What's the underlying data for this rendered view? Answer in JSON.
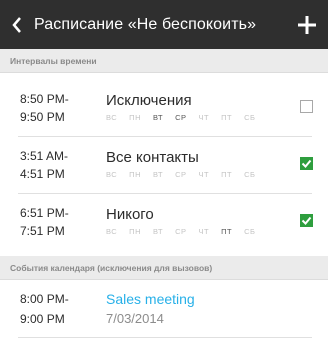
{
  "appbar": {
    "title": "Расписание «Не беспокоить»",
    "back_icon": "chevron-left-icon",
    "add_icon": "plus-icon"
  },
  "sections": {
    "intervals_header": "Интервалы времени",
    "calendar_header": "События календаря (исключения для вызовов)"
  },
  "intervals": [
    {
      "time_start": "8:50 PM-",
      "time_end": "9:50 PM",
      "name": "Исключения",
      "days": [
        {
          "label": "ВС",
          "on": false
        },
        {
          "label": "ПН",
          "on": false
        },
        {
          "label": "ВТ",
          "on": true
        },
        {
          "label": "СР",
          "on": true
        },
        {
          "label": "ЧТ",
          "on": false
        },
        {
          "label": "ПТ",
          "on": false
        },
        {
          "label": "СБ",
          "on": false
        }
      ],
      "checked": false
    },
    {
      "time_start": "3:51 AM-",
      "time_end": "4:51 PM",
      "name": "Все контакты",
      "days": [
        {
          "label": "ВС",
          "on": false
        },
        {
          "label": "ПН",
          "on": false
        },
        {
          "label": "ВТ",
          "on": false
        },
        {
          "label": "СР",
          "on": false
        },
        {
          "label": "ЧТ",
          "on": false
        },
        {
          "label": "ПТ",
          "on": false
        },
        {
          "label": "СБ",
          "on": false
        }
      ],
      "checked": true
    },
    {
      "time_start": "6:51 PM-",
      "time_end": "7:51 PM",
      "name": "Никого",
      "days": [
        {
          "label": "ВС",
          "on": false
        },
        {
          "label": "ПН",
          "on": false
        },
        {
          "label": "ВТ",
          "on": false
        },
        {
          "label": "СР",
          "on": false
        },
        {
          "label": "ЧТ",
          "on": false
        },
        {
          "label": "ПТ",
          "on": true
        },
        {
          "label": "СБ",
          "on": false
        }
      ],
      "checked": true
    }
  ],
  "events": [
    {
      "time_start": "8:00 PM-",
      "time_end": "9:00 PM",
      "title": "Sales meeting",
      "date": "7/03/2014"
    }
  ],
  "colors": {
    "appbar_bg": "#2f2f2f",
    "accent_green": "#2e9e3e",
    "event_title": "#27b0e8"
  }
}
